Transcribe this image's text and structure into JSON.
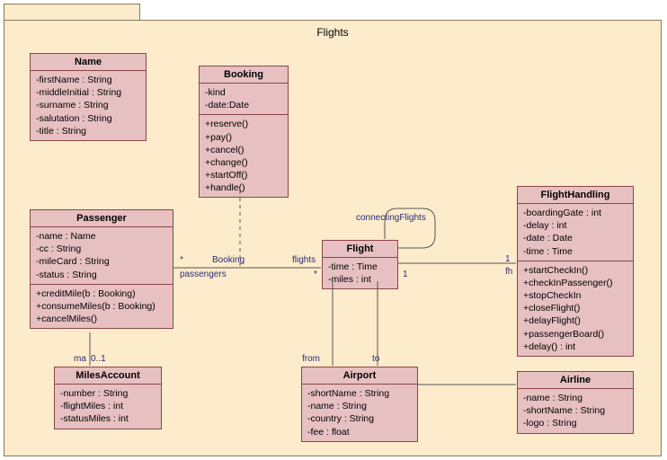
{
  "package": {
    "title": "Flights"
  },
  "classes": {
    "name": {
      "title": "Name",
      "attrs": "-firstName : String\n-middleInitial : String\n-surname : String\n-salutation : String\n-title : String"
    },
    "booking": {
      "title": "Booking",
      "attrs": "-kind\n-date:Date",
      "ops": "+reserve()\n+pay()\n+cancel()\n+change()\n+startOff()\n+handle()"
    },
    "passenger": {
      "title": "Passenger",
      "attrs": "-name : Name\n-cc : String\n-mileCard : String\n-status : String",
      "ops": "+creditMile(b : Booking)\n+consumeMiles(b : Booking)\n+cancelMiles()"
    },
    "flight": {
      "title": "Flight",
      "attrs": "-time : Time\n-miles : int"
    },
    "flighthandling": {
      "title": "FlightHandling",
      "attrs": "-boardingGate : int\n-delay : int\n-date : Date\n-time : Time",
      "ops": "+startCheckIn()\n+checkInPassenger()\n+stopCheckIn\n+closeFlight()\n+delayFlight()\n+passengerBoard()\n+delay() : int"
    },
    "milesaccount": {
      "title": "MilesAccount",
      "attrs": "-number : String\n-flightMiles : int\n-statusMiles : int"
    },
    "airport": {
      "title": "Airport",
      "attrs": "-shortName : String\n-name : String\n-country : String\n-fee : float"
    },
    "airline": {
      "title": "Airline",
      "attrs": "-name : String\n-shortName : String\n-logo : String"
    }
  },
  "labels": {
    "connectingFlights": "connectingFlights",
    "booking": "Booking",
    "passengers_star": "*",
    "passengers": "passengers",
    "flights": "flights",
    "flights_star": "*",
    "one_flight": "1",
    "one_fh": "1",
    "fh": "fh",
    "ma": "ma",
    "ma01": "0..1",
    "from": "from",
    "to": "to"
  }
}
